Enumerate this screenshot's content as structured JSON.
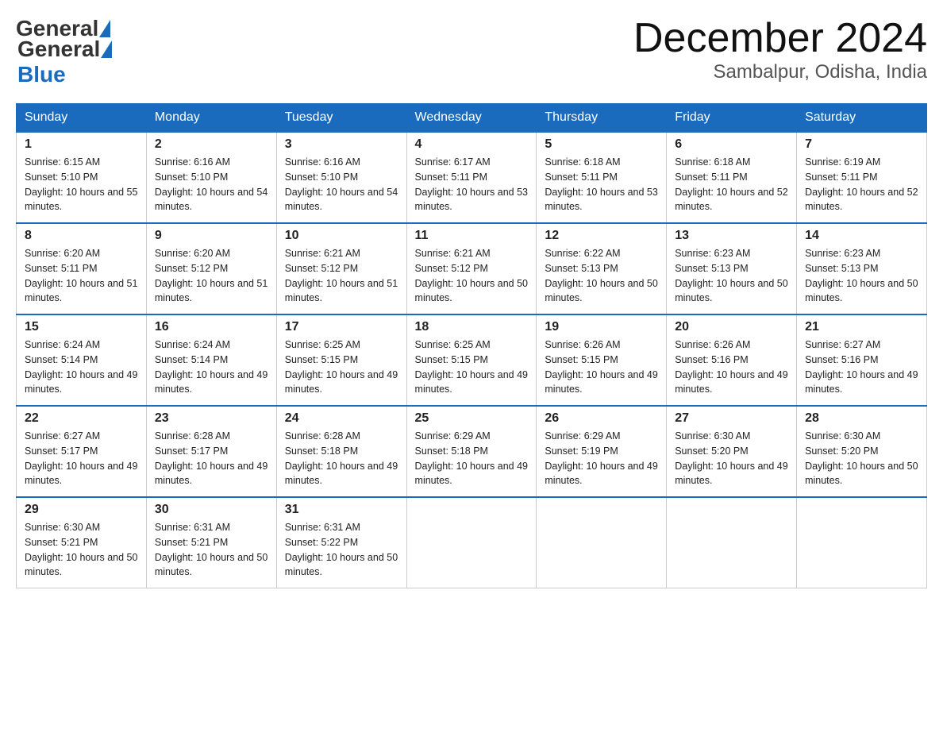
{
  "logo": {
    "general": "General",
    "blue": "Blue"
  },
  "header": {
    "month": "December 2024",
    "location": "Sambalpur, Odisha, India"
  },
  "days_of_week": [
    "Sunday",
    "Monday",
    "Tuesday",
    "Wednesday",
    "Thursday",
    "Friday",
    "Saturday"
  ],
  "weeks": [
    [
      {
        "day": "1",
        "sunrise": "6:15 AM",
        "sunset": "5:10 PM",
        "daylight": "10 hours and 55 minutes."
      },
      {
        "day": "2",
        "sunrise": "6:16 AM",
        "sunset": "5:10 PM",
        "daylight": "10 hours and 54 minutes."
      },
      {
        "day": "3",
        "sunrise": "6:16 AM",
        "sunset": "5:10 PM",
        "daylight": "10 hours and 54 minutes."
      },
      {
        "day": "4",
        "sunrise": "6:17 AM",
        "sunset": "5:11 PM",
        "daylight": "10 hours and 53 minutes."
      },
      {
        "day": "5",
        "sunrise": "6:18 AM",
        "sunset": "5:11 PM",
        "daylight": "10 hours and 53 minutes."
      },
      {
        "day": "6",
        "sunrise": "6:18 AM",
        "sunset": "5:11 PM",
        "daylight": "10 hours and 52 minutes."
      },
      {
        "day": "7",
        "sunrise": "6:19 AM",
        "sunset": "5:11 PM",
        "daylight": "10 hours and 52 minutes."
      }
    ],
    [
      {
        "day": "8",
        "sunrise": "6:20 AM",
        "sunset": "5:11 PM",
        "daylight": "10 hours and 51 minutes."
      },
      {
        "day": "9",
        "sunrise": "6:20 AM",
        "sunset": "5:12 PM",
        "daylight": "10 hours and 51 minutes."
      },
      {
        "day": "10",
        "sunrise": "6:21 AM",
        "sunset": "5:12 PM",
        "daylight": "10 hours and 51 minutes."
      },
      {
        "day": "11",
        "sunrise": "6:21 AM",
        "sunset": "5:12 PM",
        "daylight": "10 hours and 50 minutes."
      },
      {
        "day": "12",
        "sunrise": "6:22 AM",
        "sunset": "5:13 PM",
        "daylight": "10 hours and 50 minutes."
      },
      {
        "day": "13",
        "sunrise": "6:23 AM",
        "sunset": "5:13 PM",
        "daylight": "10 hours and 50 minutes."
      },
      {
        "day": "14",
        "sunrise": "6:23 AM",
        "sunset": "5:13 PM",
        "daylight": "10 hours and 50 minutes."
      }
    ],
    [
      {
        "day": "15",
        "sunrise": "6:24 AM",
        "sunset": "5:14 PM",
        "daylight": "10 hours and 49 minutes."
      },
      {
        "day": "16",
        "sunrise": "6:24 AM",
        "sunset": "5:14 PM",
        "daylight": "10 hours and 49 minutes."
      },
      {
        "day": "17",
        "sunrise": "6:25 AM",
        "sunset": "5:15 PM",
        "daylight": "10 hours and 49 minutes."
      },
      {
        "day": "18",
        "sunrise": "6:25 AM",
        "sunset": "5:15 PM",
        "daylight": "10 hours and 49 minutes."
      },
      {
        "day": "19",
        "sunrise": "6:26 AM",
        "sunset": "5:15 PM",
        "daylight": "10 hours and 49 minutes."
      },
      {
        "day": "20",
        "sunrise": "6:26 AM",
        "sunset": "5:16 PM",
        "daylight": "10 hours and 49 minutes."
      },
      {
        "day": "21",
        "sunrise": "6:27 AM",
        "sunset": "5:16 PM",
        "daylight": "10 hours and 49 minutes."
      }
    ],
    [
      {
        "day": "22",
        "sunrise": "6:27 AM",
        "sunset": "5:17 PM",
        "daylight": "10 hours and 49 minutes."
      },
      {
        "day": "23",
        "sunrise": "6:28 AM",
        "sunset": "5:17 PM",
        "daylight": "10 hours and 49 minutes."
      },
      {
        "day": "24",
        "sunrise": "6:28 AM",
        "sunset": "5:18 PM",
        "daylight": "10 hours and 49 minutes."
      },
      {
        "day": "25",
        "sunrise": "6:29 AM",
        "sunset": "5:18 PM",
        "daylight": "10 hours and 49 minutes."
      },
      {
        "day": "26",
        "sunrise": "6:29 AM",
        "sunset": "5:19 PM",
        "daylight": "10 hours and 49 minutes."
      },
      {
        "day": "27",
        "sunrise": "6:30 AM",
        "sunset": "5:20 PM",
        "daylight": "10 hours and 49 minutes."
      },
      {
        "day": "28",
        "sunrise": "6:30 AM",
        "sunset": "5:20 PM",
        "daylight": "10 hours and 50 minutes."
      }
    ],
    [
      {
        "day": "29",
        "sunrise": "6:30 AM",
        "sunset": "5:21 PM",
        "daylight": "10 hours and 50 minutes."
      },
      {
        "day": "30",
        "sunrise": "6:31 AM",
        "sunset": "5:21 PM",
        "daylight": "10 hours and 50 minutes."
      },
      {
        "day": "31",
        "sunrise": "6:31 AM",
        "sunset": "5:22 PM",
        "daylight": "10 hours and 50 minutes."
      },
      null,
      null,
      null,
      null
    ]
  ]
}
